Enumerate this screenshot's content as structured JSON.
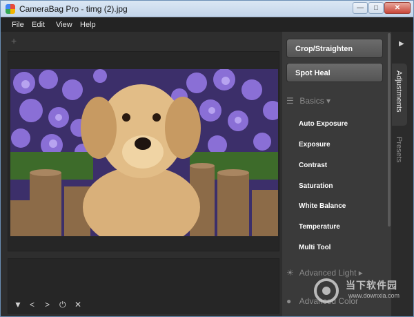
{
  "window": {
    "title": "CameraBag Pro - timg (2).jpg",
    "controls": {
      "minimize": "—",
      "maximize": "□",
      "close": "✕"
    }
  },
  "menu": [
    "File",
    "Edit",
    "View",
    "Help"
  ],
  "workspace": {
    "add_symbol": "+",
    "filmstrip_buttons": [
      "▼",
      "<",
      ">",
      "⏻",
      "✕"
    ]
  },
  "right_panel": {
    "buttons": [
      "Crop/Straighten",
      "Spot Heal"
    ],
    "sections": {
      "basics": {
        "label": "Basics",
        "items": [
          "Auto Exposure",
          "Exposure",
          "Contrast",
          "Saturation",
          "White Balance",
          "Temperature",
          "Multi Tool"
        ]
      },
      "advanced_light": {
        "label": "Advanced Light"
      },
      "advanced_color": {
        "label": "Advanced Color"
      }
    }
  },
  "tabs": {
    "collapse_arrow": "▶",
    "items": [
      "Adjustments",
      "Presets"
    ]
  },
  "watermark": {
    "text": "当下软件园",
    "url": "www.downxia.com"
  },
  "colors": {
    "panel": "#3a3a3a",
    "workspace": "#2e2e2e",
    "titlebar": "#c3d5ea"
  }
}
